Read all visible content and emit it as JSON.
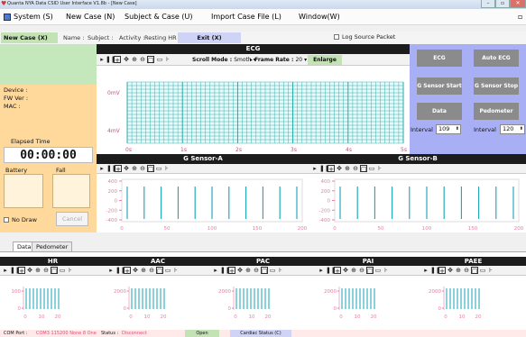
{
  "window": {
    "title": "Quanta NYA Data CSID User Interface V1.8b - [New Case]",
    "minimize": "–",
    "restore": "▫",
    "close": "✕"
  },
  "menu": [
    "System (S)",
    "New Case (N)",
    "Subject & Case (U)",
    "Import Case File (L)",
    "Window(W)"
  ],
  "toolbar": {
    "new_case": "New Case (X)",
    "name": "Name :",
    "subject": "Subject :",
    "activity": "Activity :",
    "resting_hr": "Resting HR :",
    "exit": "Exit (X)",
    "log": "Log Source Packet"
  },
  "device": {
    "device": "Device :",
    "fw": "FW Ver :",
    "mac": "MAC :"
  },
  "elapsed": {
    "label": "Elapsed Time",
    "value": "00:00:00",
    "battery": "Battery",
    "fall": "Fall"
  },
  "controls": {
    "no_draw": "No Draw",
    "cancel": "Cancel"
  },
  "ecg": {
    "title": "ECG",
    "scroll_mode_label": "Scroll Mode :",
    "scroll_mode": "Smoth",
    "frame_rate_label": "Frame Rate :",
    "frame_rate": "20",
    "enlarge": "Enlarge",
    "y_labels": [
      "0mV",
      "4mV"
    ],
    "x_labels": [
      "0s",
      "1s",
      "2s",
      "3s",
      "4s",
      "5s"
    ]
  },
  "right": {
    "ecg": "ECG",
    "auto_ecg": "Auto ECG",
    "g_start": "G Sensor Start",
    "g_stop": "G Sensor Stop",
    "data": "Data",
    "pedometer": "Pedometer",
    "interval_label": "Interval",
    "interval1": "109",
    "interval2": "120"
  },
  "gsensor_a": {
    "title": "G Sensor-A",
    "y_ticks": [
      "400",
      "200",
      "0",
      "-200",
      "-400"
    ],
    "x_ticks": [
      "0",
      "50",
      "100",
      "150",
      "200"
    ]
  },
  "gsensor_b": {
    "title": "G Sensor-B",
    "y_ticks": [
      "400",
      "200",
      "0",
      "-200",
      "-400"
    ],
    "x_ticks": [
      "0",
      "50",
      "100",
      "150",
      "200"
    ]
  },
  "tabs": [
    "Data",
    "Pedometer"
  ],
  "metrics": [
    {
      "title": "HR",
      "y_ticks": [
        "100",
        "0"
      ],
      "x_ticks": [
        "0",
        "10",
        "20"
      ]
    },
    {
      "title": "AAC",
      "y_ticks": [
        "2000",
        "0"
      ],
      "x_ticks": [
        "0",
        "10",
        "20"
      ]
    },
    {
      "title": "PAC",
      "y_ticks": [
        "2000",
        "0"
      ],
      "x_ticks": [
        "0",
        "10",
        "20"
      ]
    },
    {
      "title": "PAI",
      "y_ticks": [
        "2000",
        "0"
      ],
      "x_ticks": [
        "0",
        "10",
        "20"
      ]
    },
    {
      "title": "PAEE",
      "y_ticks": [
        "2000",
        "0"
      ],
      "x_ticks": [
        "0",
        "10",
        "20"
      ]
    }
  ],
  "status": {
    "port": "COM Port :",
    "port_val": "COM3 115200 None 8 One",
    "status": "Status :",
    "status_val": "Disconnect",
    "open": "Open",
    "cardiac": "Cardiac Status (C)"
  },
  "colors": {
    "ecg_grid": "#13a0a0",
    "bars": "#16a3b5",
    "accent_green": "#c4e3b4",
    "accent_blue": "#a9aff5",
    "left_panel": "#ffd99b"
  }
}
